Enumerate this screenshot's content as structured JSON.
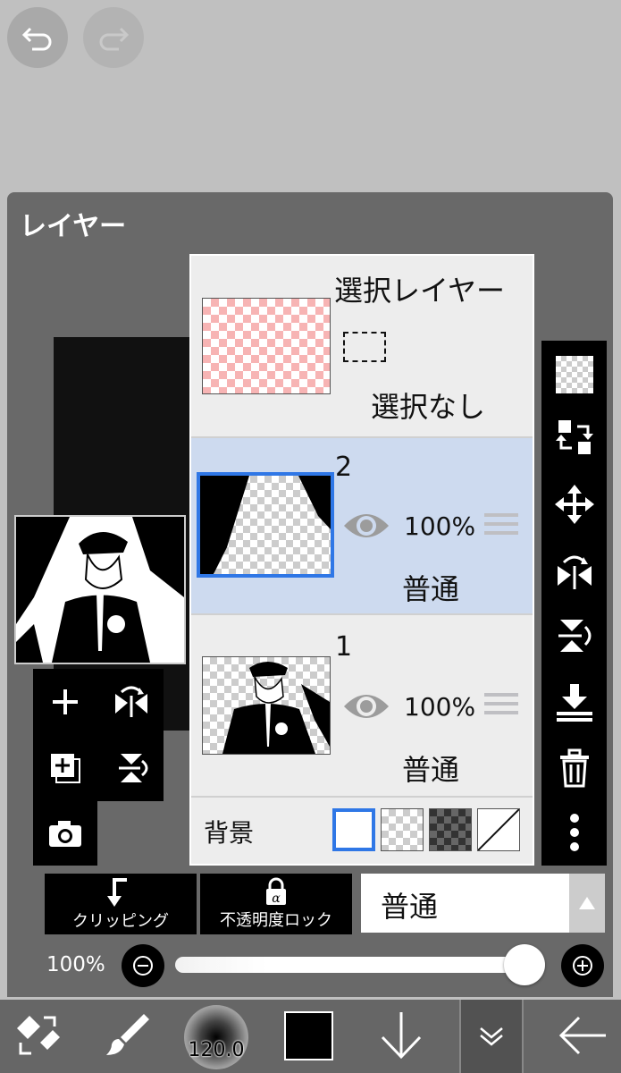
{
  "panel": {
    "title": "レイヤー"
  },
  "selection_layer": {
    "title": "選択レイヤー",
    "status": "選択なし"
  },
  "layers": [
    {
      "number": "2",
      "opacity": "100%",
      "blend": "普通",
      "selected": true
    },
    {
      "number": "1",
      "opacity": "100%",
      "blend": "普通",
      "selected": false
    }
  ],
  "background": {
    "label": "背景"
  },
  "controls": {
    "clipping_label": "クリッピング",
    "opacity_lock_label": "不透明度ロック",
    "blend_mode": "普通",
    "opacity_value": "100%",
    "opacity_fraction": 1.0
  },
  "toolbar": {
    "brush_size": "120.0"
  },
  "colors": {
    "selected_layer_bg": "#cddaef",
    "accent": "#2f77e6",
    "brush_color": "#000000"
  }
}
